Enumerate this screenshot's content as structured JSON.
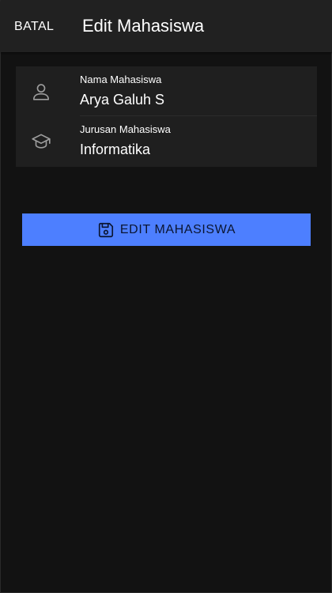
{
  "header": {
    "cancel_label": "BATAL",
    "title": "Edit Mahasiswa"
  },
  "form": {
    "fields": [
      {
        "label": "Nama Mahasiswa",
        "value": "Arya Galuh S",
        "icon": "person-icon"
      },
      {
        "label": "Jurusan Mahasiswa",
        "value": "Informatika",
        "icon": "graduation-cap-icon"
      }
    ],
    "submit": {
      "label": "EDIT MAHASISWA",
      "icon": "floppy-disk-icon"
    }
  },
  "colors": {
    "background": "#121212",
    "header": "#212121",
    "card": "#1f1f1f",
    "accent": "#4d7fff",
    "text": "#ffffff",
    "icon": "#9e9e9e"
  }
}
